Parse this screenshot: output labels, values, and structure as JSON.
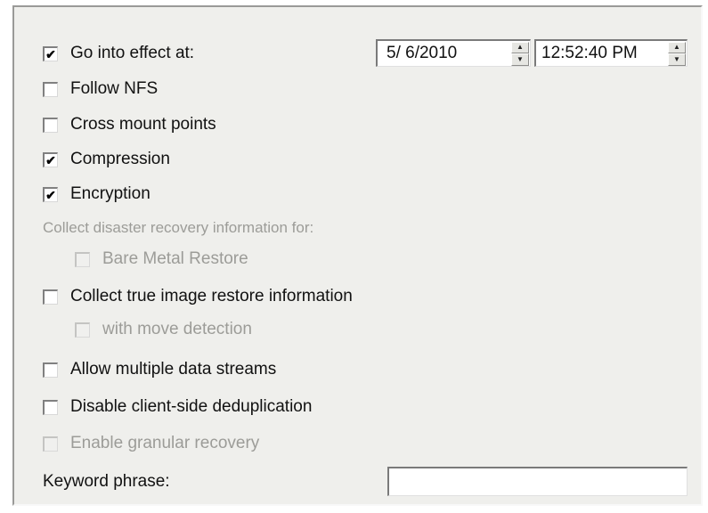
{
  "options": {
    "effect": {
      "label": "Go into effect at:",
      "checked": true
    },
    "follow_nfs": {
      "label": "Follow NFS",
      "checked": false
    },
    "cross_mount": {
      "label": "Cross mount points",
      "checked": false
    },
    "compression": {
      "label": "Compression",
      "checked": true
    },
    "encryption": {
      "label": "Encryption",
      "checked": true
    },
    "disaster_heading": "Collect disaster recovery information for:",
    "bare_metal": {
      "label": "Bare Metal Restore",
      "checked": false,
      "enabled": false
    },
    "true_image": {
      "label": "Collect true image restore information",
      "checked": false
    },
    "move_detection": {
      "label": "with move detection",
      "checked": false,
      "enabled": false
    },
    "multi_streams": {
      "label": "Allow multiple data streams",
      "checked": false
    },
    "dedup": {
      "label": "Disable client-side deduplication",
      "checked": false
    },
    "granular": {
      "label": "Enable granular recovery",
      "checked": false,
      "enabled": false
    }
  },
  "date_field": {
    "value": "5/  6/2010"
  },
  "time_field": {
    "value": "12:52:40 PM"
  },
  "keyword": {
    "label": "Keyword phrase:",
    "value": ""
  },
  "icons": {
    "checkmark": "✔",
    "spin_up": "▲",
    "spin_down": "▼"
  }
}
